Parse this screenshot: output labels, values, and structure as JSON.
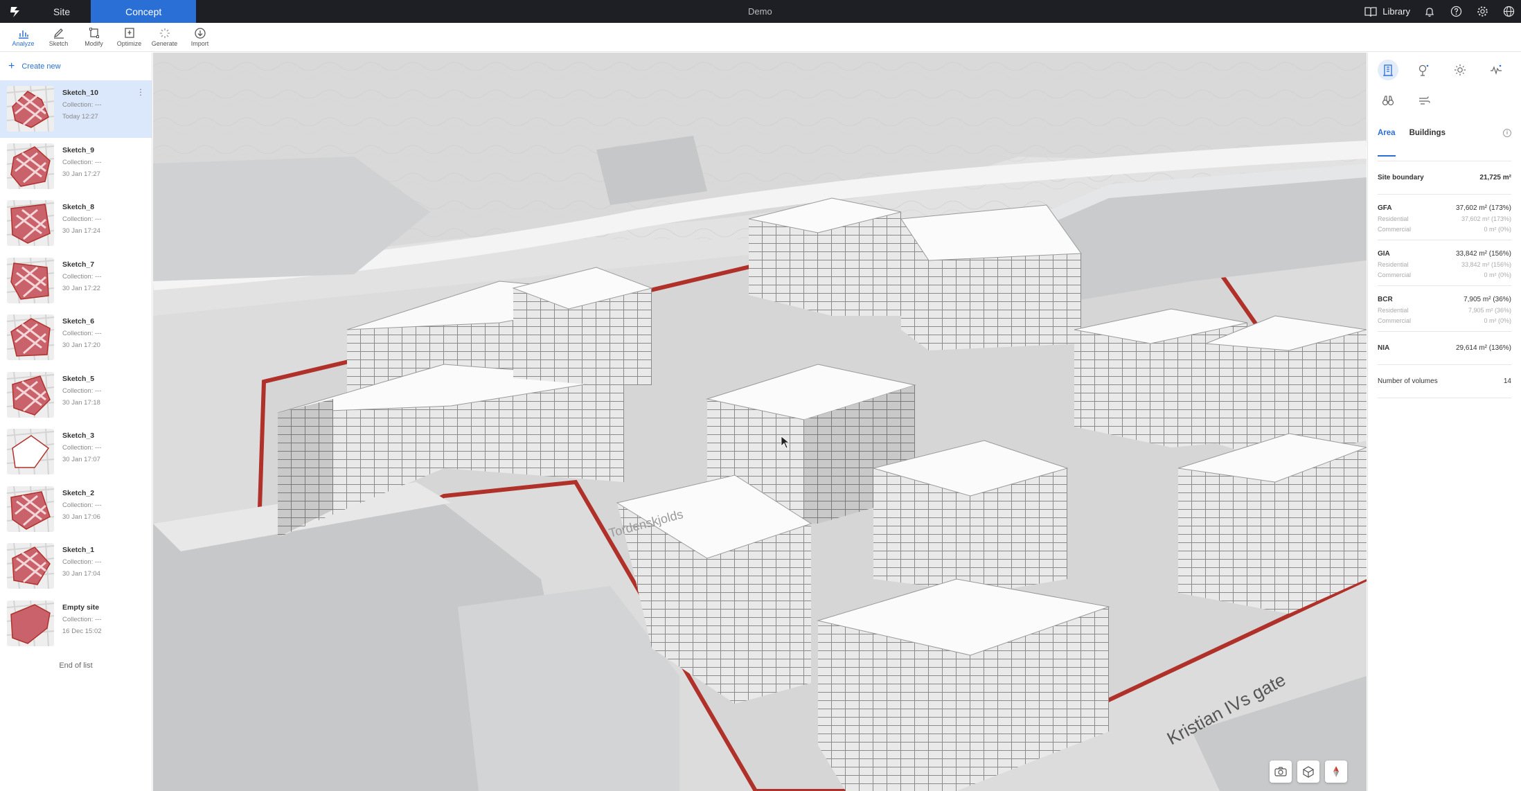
{
  "topbar": {
    "tabs": [
      {
        "label": "Site"
      },
      {
        "label": "Concept"
      }
    ],
    "project_name": "Demo",
    "library_label": "Library"
  },
  "toolbar": {
    "tools": [
      {
        "label": "Analyze",
        "icon": "chart-icon"
      },
      {
        "label": "Sketch",
        "icon": "pencil-icon"
      },
      {
        "label": "Modify",
        "icon": "square-select-icon"
      },
      {
        "label": "Optimize",
        "icon": "optimize-icon"
      },
      {
        "label": "Generate",
        "icon": "sparkle-icon"
      },
      {
        "label": "Import",
        "icon": "download-icon"
      }
    ]
  },
  "sidebar": {
    "create_label": "Create new",
    "items": [
      {
        "name": "Sketch_10",
        "collection": "Collection: ---",
        "date": "Today 12:27"
      },
      {
        "name": "Sketch_9",
        "collection": "Collection: ---",
        "date": "30 Jan 17:27"
      },
      {
        "name": "Sketch_8",
        "collection": "Collection: ---",
        "date": "30 Jan 17:24"
      },
      {
        "name": "Sketch_7",
        "collection": "Collection: ---",
        "date": "30 Jan 17:22"
      },
      {
        "name": "Sketch_6",
        "collection": "Collection: ---",
        "date": "30 Jan 17:20"
      },
      {
        "name": "Sketch_5",
        "collection": "Collection: ---",
        "date": "30 Jan 17:18"
      },
      {
        "name": "Sketch_3",
        "collection": "Collection: ---",
        "date": "30 Jan 17:07"
      },
      {
        "name": "Sketch_2",
        "collection": "Collection: ---",
        "date": "30 Jan 17:06"
      },
      {
        "name": "Sketch_1",
        "collection": "Collection: ---",
        "date": "30 Jan 17:04"
      },
      {
        "name": "Empty site",
        "collection": "Collection: ---",
        "date": "16 Dec 15:02"
      }
    ],
    "end_label": "End of list"
  },
  "map": {
    "street_label_1": "Kristian IVs gate",
    "street_label_2": "Tordenskjolds"
  },
  "panel": {
    "tabs": [
      {
        "label": "Area"
      },
      {
        "label": "Buildings"
      }
    ],
    "site_boundary": {
      "label": "Site boundary",
      "value": "21,725 m²"
    },
    "gfa": {
      "label": "GFA",
      "value": "37,602 m² (173%)",
      "res_label": "Residential",
      "res_value": "37,602 m² (173%)",
      "com_label": "Commercial",
      "com_value": "0 m² (0%)"
    },
    "gia": {
      "label": "GIA",
      "value": "33,842 m² (156%)",
      "res_label": "Residential",
      "res_value": "33,842 m² (156%)",
      "com_label": "Commercial",
      "com_value": "0 m² (0%)"
    },
    "bcr": {
      "label": "BCR",
      "value": "7,905 m² (36%)",
      "res_label": "Residential",
      "res_value": "7,905 m² (36%)",
      "com_label": "Commercial",
      "com_value": "0 m² (0%)"
    },
    "nia": {
      "label": "NIA",
      "value": "29,614 m² (136%)"
    },
    "volumes": {
      "label": "Number of volumes",
      "value": "14"
    }
  },
  "colors": {
    "accent": "#2a6fd6",
    "site_boundary": "#b0302a",
    "topbar": "#1e1f24"
  }
}
